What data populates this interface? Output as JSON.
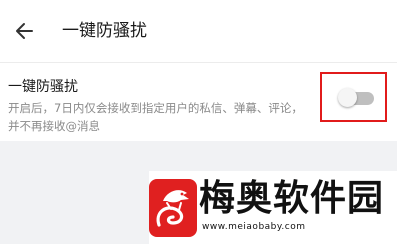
{
  "header": {
    "back_icon": "arrow-left-icon",
    "title": "一键防骚扰"
  },
  "setting": {
    "title": "一键防骚扰",
    "description": "开启后，7日内仅会接收到指定用户的私信、弹幕、评论，并不再接收@消息",
    "toggle_state": "off",
    "highlight_color": "#e11b1b"
  },
  "watermark": {
    "logo_icon": "dragon-logo-icon",
    "name": "梅奥软件园",
    "url": "www.meiaobaby.com"
  }
}
